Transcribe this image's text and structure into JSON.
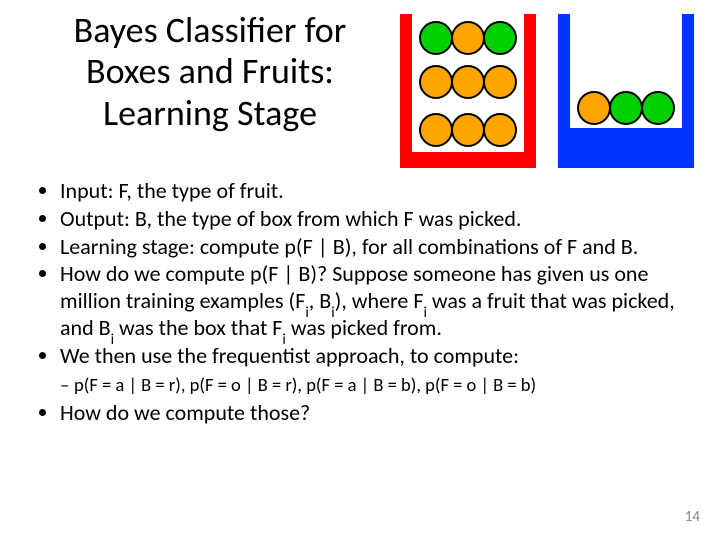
{
  "title_l1": "Bayes Classifier for",
  "title_l2": "Boxes and Fruits:",
  "title_l3": "Learning Stage",
  "b1": "Input: F, the type of fruit.",
  "b2": "Output: B, the type of box from which F was picked.",
  "b3": "Learning stage: compute p(F | B), for all combinations of F and B.",
  "b4a": "How do we compute p(F | B)? Suppose someone has given us one million training examples (F",
  "b4b": ", B",
  "b4c": "), where F",
  "b4d": " was a fruit that was picked, and B",
  "b4e": " was the box that F",
  "b4f": " was picked from.",
  "sub_i": "i",
  "b5": "We then use the frequentist approach, to compute:",
  "sub1": "p(F = a | B = r), p(F = o | B = r), p(F = a | B = b), p(F = o | B = b)",
  "b6": "How do we compute those?",
  "page": "14",
  "colors": {
    "red": "#FF0000",
    "blue": "#0033FF",
    "orange": "#FFA500",
    "green": "#00D000"
  }
}
